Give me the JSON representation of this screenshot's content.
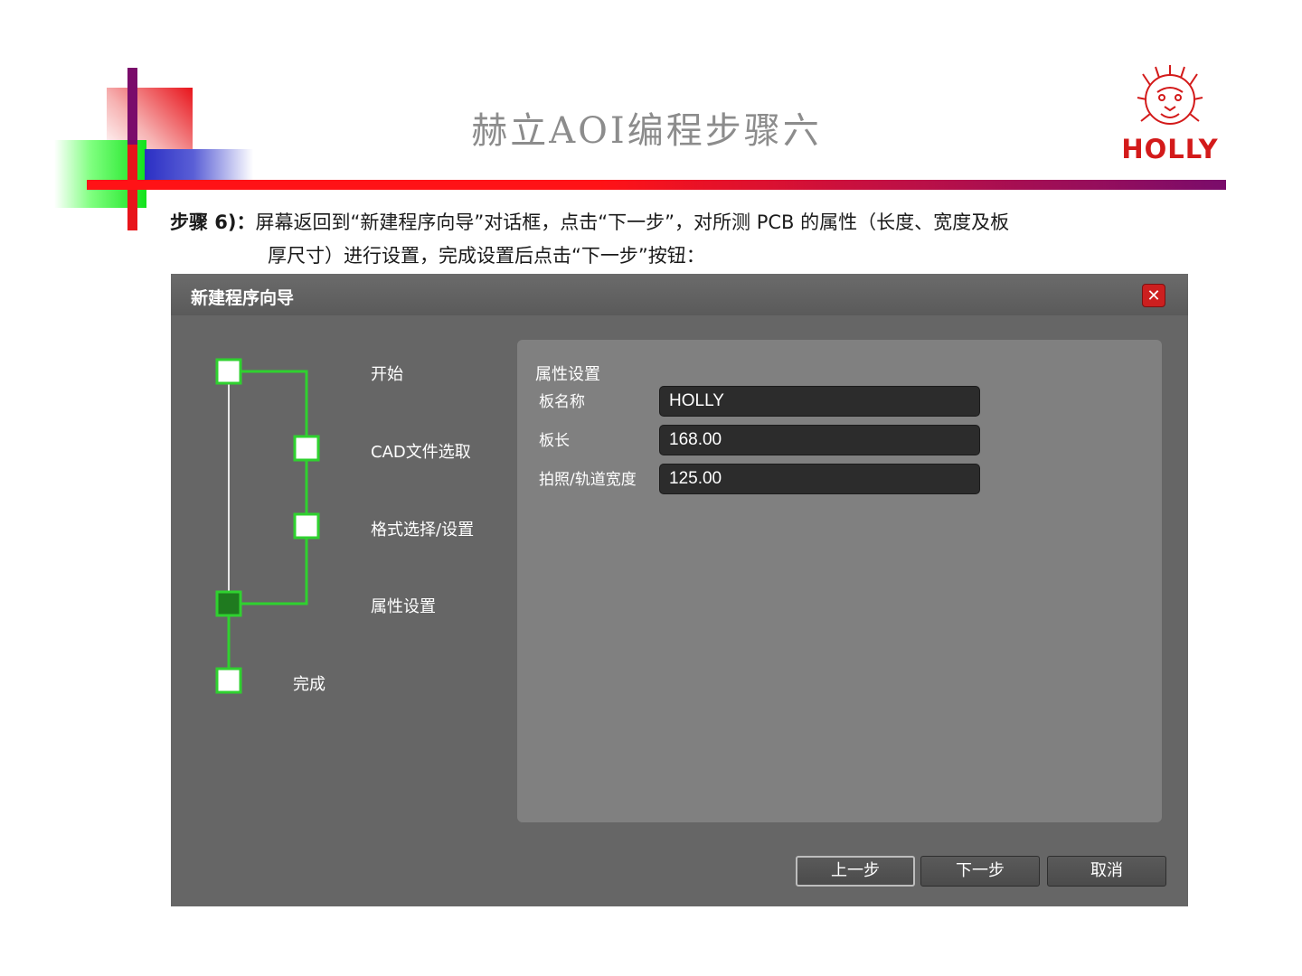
{
  "slide": {
    "title": "赫立AOI编程步骤六",
    "logo_text": "HOLLY",
    "instruction_lead": "步骤 6)：",
    "instruction_line1": "屏幕返回到“新建程序向导”对话框，点击“下一步”，对所测 PCB 的属性（长度、宽度及板",
    "instruction_line2": "厚尺寸）进行设置，完成设置后点击“下一步”按钮："
  },
  "dialog": {
    "title": "新建程序向导",
    "close_icon": "close-icon",
    "steps": [
      {
        "label": "开始",
        "state": "done"
      },
      {
        "label": "CAD文件选取",
        "state": "skipped"
      },
      {
        "label": "格式选择/设置",
        "state": "skipped"
      },
      {
        "label": "属性设置",
        "state": "current"
      },
      {
        "label": "完成",
        "state": "pending"
      }
    ],
    "panel": {
      "title": "属性设置",
      "fields": [
        {
          "label": "板名称",
          "value": "HOLLY"
        },
        {
          "label": "板长",
          "value": "168.00"
        },
        {
          "label": "拍照/轨道宽度",
          "value": "125.00"
        }
      ]
    },
    "buttons": {
      "prev": "上一步",
      "next": "下一步",
      "cancel": "取消"
    }
  },
  "colors": {
    "dialog_bg": "#666666",
    "panel_bg": "#808080",
    "flow_green": "#2fd12f",
    "current_step": "#1f7a1f",
    "logo_red": "#d31a1a"
  }
}
